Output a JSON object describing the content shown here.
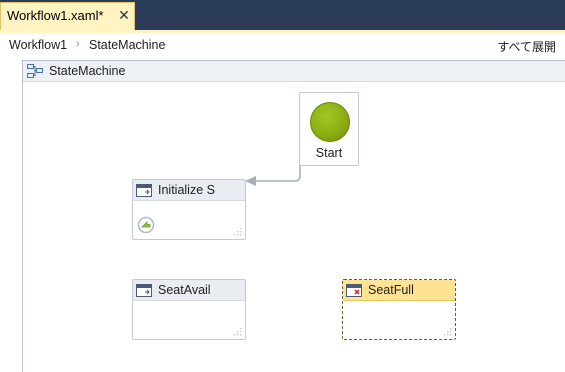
{
  "tab": {
    "title": "Workflow1.xaml*",
    "close_glyph": "✕",
    "close_icon": "close-icon"
  },
  "breadcrumb": {
    "items": [
      "Workflow1",
      "StateMachine"
    ],
    "separator": "›",
    "expand_all": "すべて展開"
  },
  "state_machine": {
    "title": "StateMachine",
    "icon": "state-machine-icon"
  },
  "start": {
    "label": "Start",
    "color": "#8cae12"
  },
  "states": [
    {
      "title": "Initialize S",
      "icon": "state-icon",
      "has_entry_action": true,
      "selected": false
    },
    {
      "title": "SeatAvail",
      "icon": "state-icon",
      "has_entry_action": false,
      "selected": false
    },
    {
      "title": "SeatFull",
      "icon": "final-state-icon",
      "has_entry_action": false,
      "selected": true
    }
  ],
  "colors": {
    "tabstrip": "#2b3c59",
    "tab_active": "#fff4c2",
    "selection_header": "#ffe392",
    "transition_line": "#a6aeb9"
  }
}
